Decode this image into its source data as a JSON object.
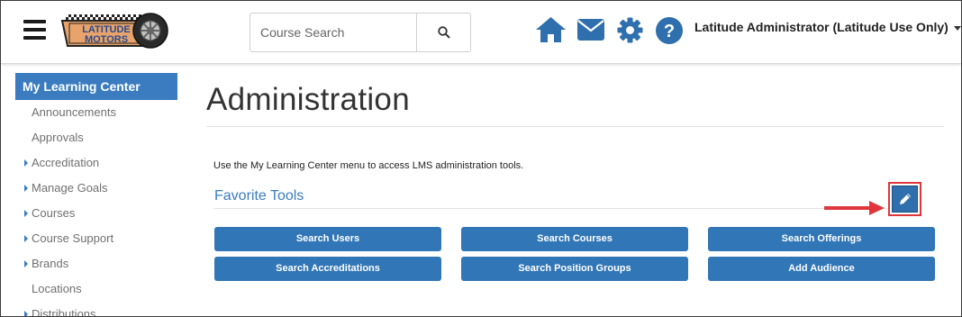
{
  "header": {
    "menu_icon": "hamburger-menu-icon",
    "logo_text_line1": "LATITUDE",
    "logo_text_line2": "MOTORS",
    "search_placeholder": "Course Search",
    "search_icon": "search-icon",
    "nav_icons": [
      "home-icon",
      "mail-icon",
      "gear-icon",
      "help-icon"
    ],
    "user_name": "Latitude Administrator (Latitude Use Only)"
  },
  "sidebar": {
    "heading": "My Learning Center",
    "items": [
      {
        "label": "Announcements",
        "expandable": false
      },
      {
        "label": "Approvals",
        "expandable": false
      },
      {
        "label": "Accreditation",
        "expandable": true
      },
      {
        "label": "Manage Goals",
        "expandable": true
      },
      {
        "label": "Courses",
        "expandable": true
      },
      {
        "label": "Course Support",
        "expandable": true
      },
      {
        "label": "Brands",
        "expandable": true
      },
      {
        "label": "Locations",
        "expandable": false
      },
      {
        "label": "Distributions",
        "expandable": true
      }
    ]
  },
  "main": {
    "title": "Administration",
    "intro": "Use the My Learning Center menu to access LMS administration tools.",
    "favorites_title": "Favorite Tools",
    "edit_icon": "pencil-icon",
    "tools": [
      "Search Users",
      "Search Courses",
      "Search Offerings",
      "Search Accreditations",
      "Search Position Groups",
      "Add Audience"
    ]
  },
  "colors": {
    "accent": "#3a7cbf",
    "button": "#3176b6",
    "highlight": "#e0353b"
  }
}
